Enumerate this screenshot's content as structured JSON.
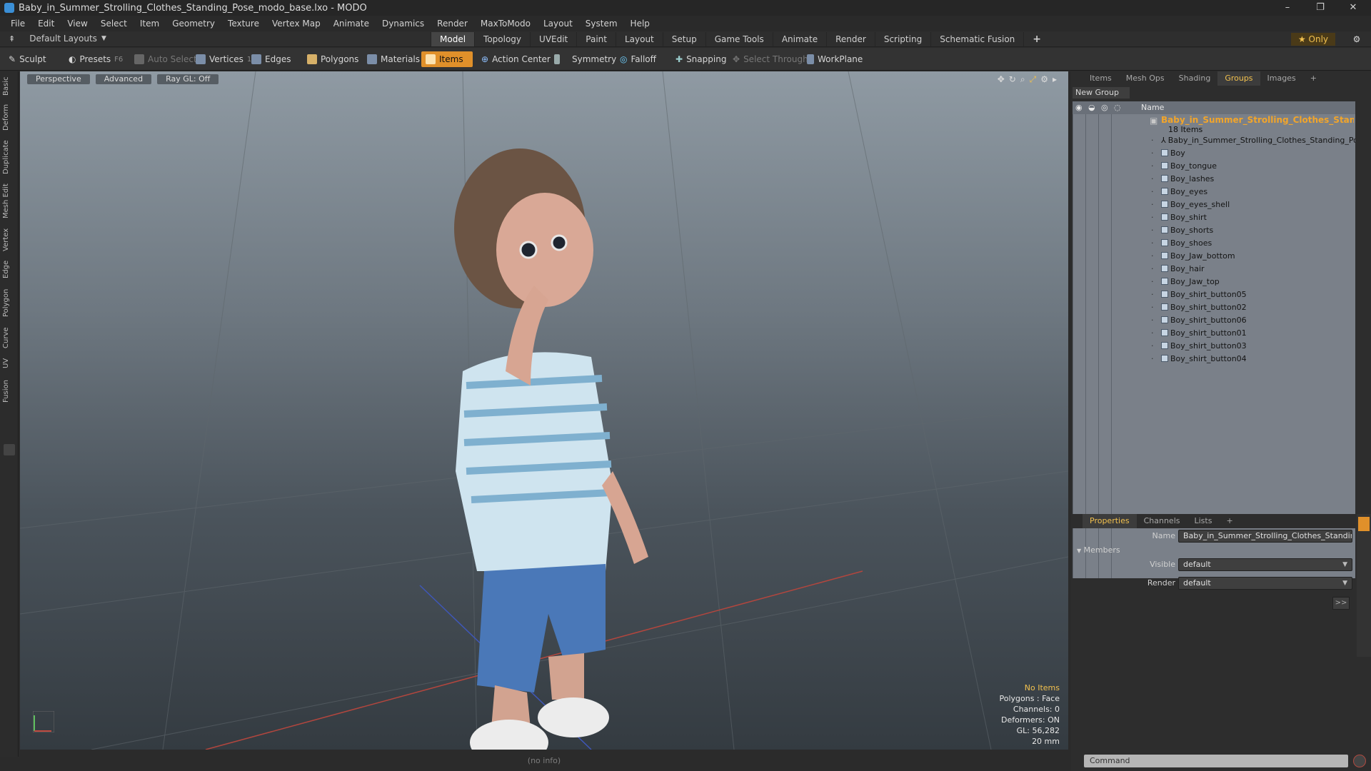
{
  "window": {
    "title": "Baby_in_Summer_Strolling_Clothes_Standing_Pose_modo_base.lxo - MODO",
    "controls": [
      "–",
      "❐",
      "✕"
    ]
  },
  "menu": [
    "File",
    "Edit",
    "View",
    "Select",
    "Item",
    "Geometry",
    "Texture",
    "Vertex Map",
    "Animate",
    "Dynamics",
    "Render",
    "MaxToModo",
    "Layout",
    "System",
    "Help"
  ],
  "layout_bar": {
    "layouts_label": "Default Layouts",
    "tabs": [
      "Model",
      "Topology",
      "UVEdit",
      "Paint",
      "Layout",
      "Setup",
      "Game Tools",
      "Animate",
      "Render",
      "Scripting",
      "Schematic Fusion"
    ],
    "active_tab": "Model",
    "add": "+",
    "only_label": "Only"
  },
  "toolbar": {
    "sculpt": "Sculpt",
    "presets": "Presets",
    "presets_key": "F6",
    "auto_select": "Auto Select",
    "vertices": "Vertices",
    "vertices_key": "1",
    "edges": "Edges",
    "edges_key": "2",
    "polygons": "Polygons",
    "materials": "Materials",
    "items": "Items",
    "action_center": "Action Center",
    "symmetry": "Symmetry",
    "falloff": "Falloff",
    "snapping": "Snapping",
    "select_through": "Select Through",
    "workplane": "WorkPlane"
  },
  "left_tabs": [
    "Basic",
    "Deform",
    "Duplicate",
    "Mesh Edit",
    "Vertex",
    "Edge",
    "Polygon",
    "Curve",
    "UV",
    "Fusion"
  ],
  "viewport": {
    "perspective": "Perspective",
    "advanced": "Advanced",
    "raygl": "Ray GL: Off",
    "info": {
      "no_items": "No Items",
      "polygons": "Polygons : Face",
      "channels": "Channels: 0",
      "deformers": "Deformers: ON",
      "gl": "GL: 56,282",
      "scale": "20 mm"
    }
  },
  "status": "(no info)",
  "panel": {
    "tabs": [
      "Items",
      "Mesh Ops",
      "Shading",
      "Groups",
      "Images"
    ],
    "active_tab": "Groups",
    "add": "+",
    "new_group": "New Group",
    "name_header": "Name",
    "group": {
      "name": "Baby_in_Summer_Strolling_Clothes_Standing...",
      "count": "18 Items"
    },
    "items": [
      "Baby_in_Summer_Strolling_Clothes_Standing_Pose",
      "Boy",
      "Boy_tongue",
      "Boy_lashes",
      "Boy_eyes",
      "Boy_eyes_shell",
      "Boy_shirt",
      "Boy_shorts",
      "Boy_shoes",
      "Boy_Jaw_bottom",
      "Boy_hair",
      "Boy_Jaw_top",
      "Boy_shirt_button05",
      "Boy_shirt_button02",
      "Boy_shirt_button06",
      "Boy_shirt_button01",
      "Boy_shirt_button03",
      "Boy_shirt_button04"
    ]
  },
  "properties": {
    "tabs": [
      "Properties",
      "Channels",
      "Lists"
    ],
    "active_tab": "Properties",
    "add": "+",
    "name_label": "Name",
    "name_value": "Baby_in_Summer_Strolling_Clothes_Standing_Po",
    "members": "Members",
    "visible_label": "Visible",
    "visible_value": "default",
    "render_label": "Render",
    "render_value": "default",
    "more": ">>",
    "command_placeholder": "Command"
  }
}
